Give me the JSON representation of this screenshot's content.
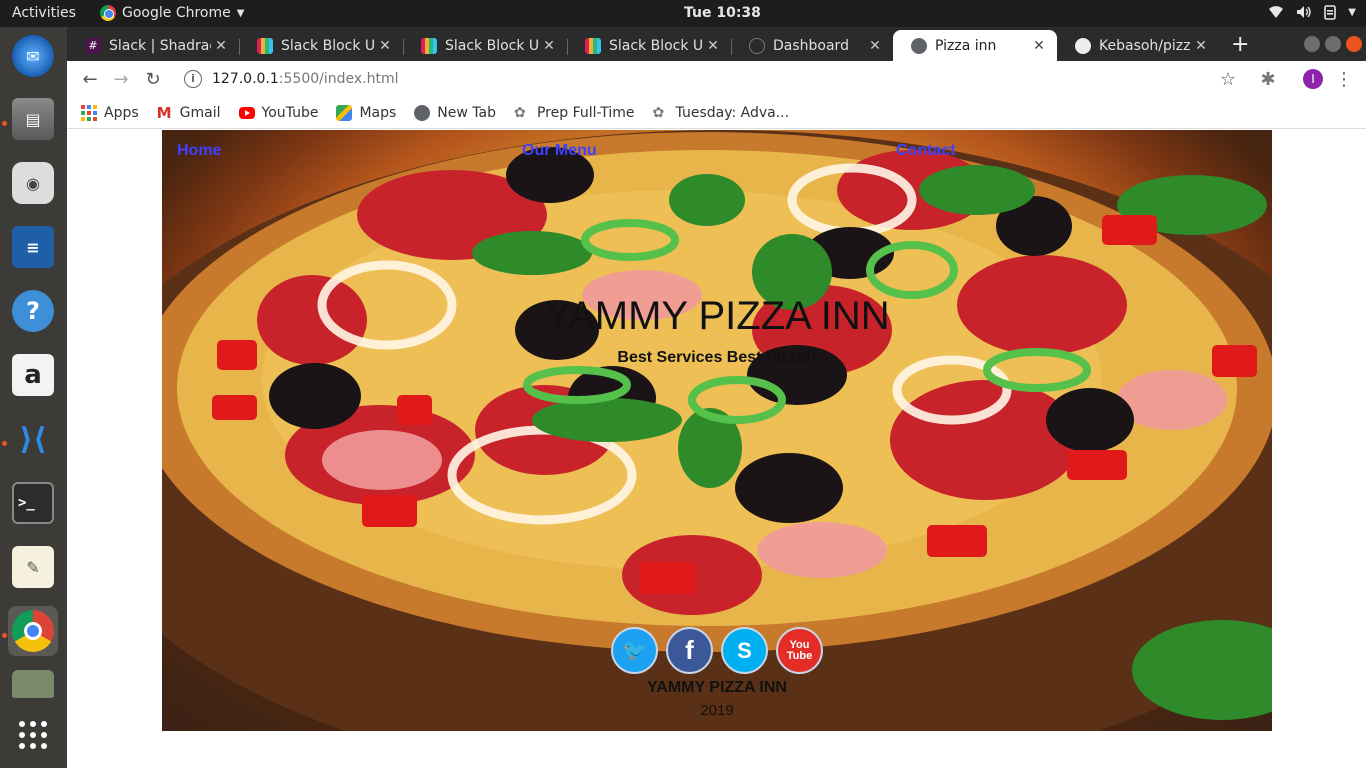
{
  "topbar": {
    "activities": "Activities",
    "app_name": "Google Chrome",
    "clock": "Tue 10:38"
  },
  "tabs": [
    {
      "title": "Slack | Shadrac",
      "icon": "slack-icon"
    },
    {
      "title": "Slack Block Use",
      "icon": "slack-block-icon"
    },
    {
      "title": "Slack Block Use",
      "icon": "slack-block-icon"
    },
    {
      "title": "Slack Block Use",
      "icon": "slack-block-icon"
    },
    {
      "title": "Dashboard",
      "icon": "dashboard-icon"
    },
    {
      "title": "Pizza inn",
      "icon": "globe-icon",
      "active": true
    },
    {
      "title": "Kebasoh/pizza",
      "icon": "github-icon"
    }
  ],
  "address": {
    "host": "127.0.0.1",
    "path": ":5500/index.html"
  },
  "bookmarks": [
    {
      "label": "Apps",
      "icon": "apps-grid-icon"
    },
    {
      "label": "Gmail",
      "icon": "gmail-icon"
    },
    {
      "label": "YouTube",
      "icon": "youtube-icon"
    },
    {
      "label": "Maps",
      "icon": "maps-icon"
    },
    {
      "label": "New Tab",
      "icon": "globe-icon"
    },
    {
      "label": "Prep Full-Time",
      "icon": "bookmark-icon"
    },
    {
      "label": "Tuesday: Adva...",
      "icon": "bookmark-icon"
    }
  ],
  "profile_initial": "I",
  "page": {
    "nav": [
      "Home",
      "Our Menu",
      "Contact"
    ],
    "title": "YAMMY PIZZA INN",
    "subtitle": "Best Services Best Pizza!!",
    "social": [
      {
        "name": "twitter",
        "glyph": "🐦",
        "color": "#1da1f2"
      },
      {
        "name": "facebook",
        "glyph": "f",
        "color": "#3b5998"
      },
      {
        "name": "skype",
        "glyph": "S",
        "color": "#00aff0"
      },
      {
        "name": "youtube",
        "glyph": "You Tube",
        "color": "#e52d27"
      }
    ],
    "footer_name": "YAMMY PIZZA INN",
    "footer_year": "2019"
  },
  "colors": {
    "link": "#4040ff",
    "accent_dock": "#e95420",
    "profile": "#8e24aa"
  }
}
